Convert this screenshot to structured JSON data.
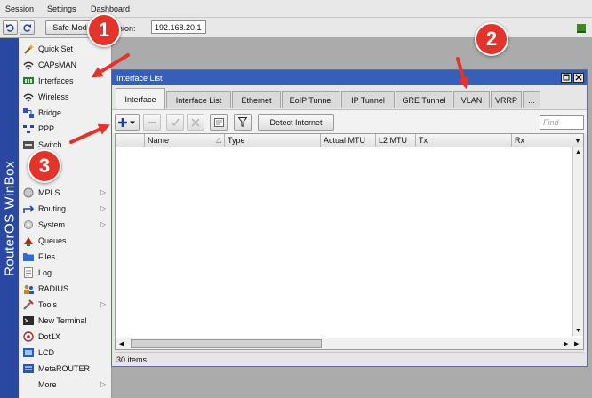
{
  "menubar": {
    "items": [
      "Session",
      "Settings",
      "Dashboard"
    ]
  },
  "toolbar": {
    "safe_mode_label": "Safe Mode",
    "session_label": "Session:",
    "session_value": "192.168.20.1"
  },
  "sidebar": {
    "brand": "RouterOS WinBox",
    "items": [
      {
        "label": "Quick Set",
        "icon": "magic-wand-icon"
      },
      {
        "label": "CAPsMAN",
        "icon": "wifi-icon"
      },
      {
        "label": "Interfaces",
        "icon": "interfaces-icon"
      },
      {
        "label": "Wireless",
        "icon": "wifi-icon"
      },
      {
        "label": "Bridge",
        "icon": "bridge-icon"
      },
      {
        "label": "PPP",
        "icon": "ppp-icon"
      },
      {
        "label": "Switch",
        "icon": "switch-icon"
      },
      {
        "label": "MPLS",
        "icon": "mpls-icon"
      },
      {
        "label": "Routing",
        "icon": "routing-icon"
      },
      {
        "label": "System",
        "icon": "gear-icon"
      },
      {
        "label": "Queues",
        "icon": "queues-icon"
      },
      {
        "label": "Files",
        "icon": "folder-icon"
      },
      {
        "label": "Log",
        "icon": "log-icon"
      },
      {
        "label": "RADIUS",
        "icon": "users-icon"
      },
      {
        "label": "Tools",
        "icon": "tools-icon"
      },
      {
        "label": "New Terminal",
        "icon": "terminal-icon"
      },
      {
        "label": "Dot1X",
        "icon": "dot1x-icon"
      },
      {
        "label": "LCD",
        "icon": "lcd-icon"
      },
      {
        "label": "MetaROUTER",
        "icon": "metarouter-icon"
      },
      {
        "label": "More",
        "icon": ""
      }
    ]
  },
  "window": {
    "title": "Interface List",
    "tabs": [
      "Interface",
      "Interface List",
      "Ethernet",
      "EoIP Tunnel",
      "IP Tunnel",
      "GRE Tunnel",
      "VLAN",
      "VRRP",
      "..."
    ],
    "detect_label": "Detect Internet",
    "find_placeholder": "Find",
    "columns": [
      "Name",
      "Type",
      "Actual MTU",
      "L2 MTU",
      "Tx",
      "Rx"
    ],
    "status": "30 items"
  },
  "callouts": [
    "1",
    "2",
    "3"
  ],
  "colors": {
    "brand": "#2b48a0",
    "titlebar": "#355fb8",
    "callout": "#e3332a"
  }
}
